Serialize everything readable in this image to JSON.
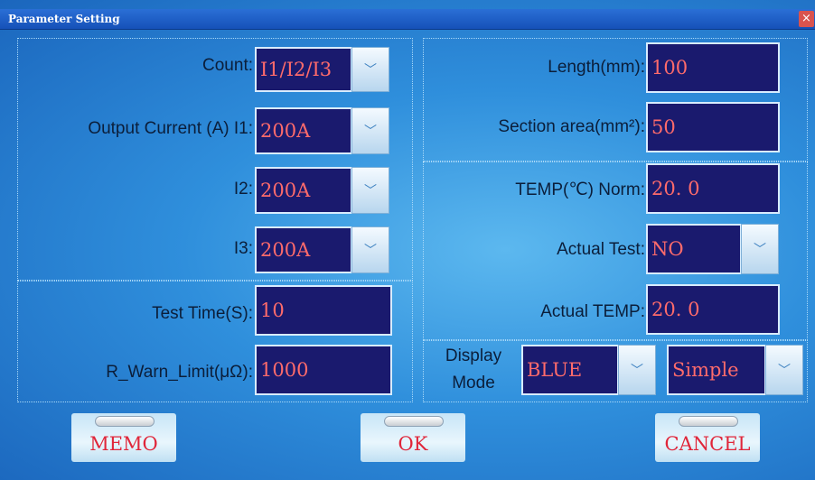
{
  "window": {
    "title": "Parameter Setting",
    "close_glyph": "×"
  },
  "left": {
    "count_label": "Count:",
    "count_value": "I1/I2/I3",
    "i1_label": "Output Current (A) I1:",
    "i1_value": "200A",
    "i2_label": "I2:",
    "i2_value": "200A",
    "i3_label": "I3:",
    "i3_value": "200A",
    "test_time_label": "Test Time(S):",
    "test_time_value": "10",
    "warn_label": "R_Warn_Limit(μΩ):",
    "warn_value": "1000"
  },
  "right": {
    "length_label": "Length(mm):",
    "length_value": "100",
    "section_label": "Section area(mm²):",
    "section_value": "50",
    "temp_norm_label": "TEMP(℃) Norm:",
    "temp_norm_value": "20. 0",
    "actual_test_label": "Actual Test:",
    "actual_test_value": "NO",
    "actual_temp_label": "Actual TEMP:",
    "actual_temp_value": "20. 0",
    "display_label_1": "Display",
    "display_label_2": "Mode",
    "display_color_value": "BLUE",
    "display_mode_value": "Simple"
  },
  "buttons": {
    "memo": "MEMO",
    "ok": "OK",
    "cancel": "CANCEL"
  },
  "icons": {
    "dropdown": "chevron-down-icon",
    "chev_glyph": "﹀"
  },
  "colors": {
    "field_bg": "#1a1a6e",
    "field_text": "#ff6b6b",
    "button_text": "#e0263a"
  }
}
